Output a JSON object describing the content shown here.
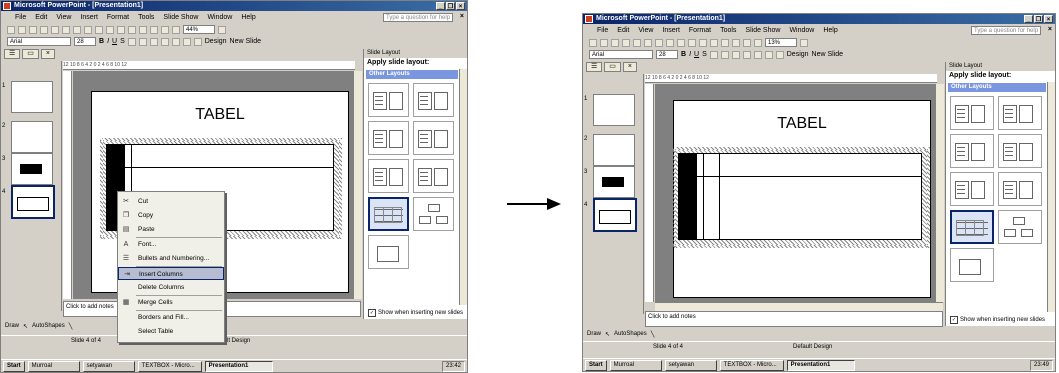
{
  "app_title": "Microsoft PowerPoint - [Presentation1]",
  "menu": [
    "File",
    "Edit",
    "View",
    "Insert",
    "Format",
    "Tools",
    "Slide Show",
    "Window",
    "Help"
  ],
  "help_placeholder": "Type a question for help",
  "formatting": {
    "font": "Arial",
    "size": "28",
    "bold": "B",
    "italic": "I",
    "underline": "U",
    "shadow": "S",
    "design_label": "Design",
    "new_slide_label": "New Slide"
  },
  "left": {
    "zoom": "44%",
    "ruler": "12 10 8 6 4 2 0 2 4 6 8 10 12",
    "notes_placeholder": "Click to add notes",
    "context_menu": [
      {
        "label": "Cut",
        "icon": "scissors-icon",
        "glyph": "✂"
      },
      {
        "label": "Copy",
        "icon": "copy-icon",
        "glyph": "❐"
      },
      {
        "label": "Paste",
        "icon": "paste-icon",
        "glyph": "▤"
      },
      {
        "label": "Font...",
        "icon": "font-icon",
        "glyph": "A"
      },
      {
        "label": "Bullets and Numbering...",
        "icon": "bullets-icon",
        "glyph": "☰"
      },
      {
        "label": "Insert Columns",
        "icon": "insert-columns-icon",
        "glyph": "⇥"
      },
      {
        "label": "Delete Columns",
        "icon": "",
        "glyph": ""
      },
      {
        "label": "Merge Cells",
        "icon": "merge-cells-icon",
        "glyph": "▦"
      },
      {
        "label": "Borders and Fill...",
        "icon": "",
        "glyph": ""
      },
      {
        "label": "Select Table",
        "icon": "",
        "glyph": ""
      }
    ],
    "task_time": "23:42"
  },
  "right": {
    "zoom": "13%",
    "ruler": "12 10 8 6 4 2 0 2 4 6 8 10 12",
    "notes_placeholder": "Click to add notes",
    "task_time": "23:49"
  },
  "slide_title": "TABEL",
  "thumbnails": [
    "1",
    "2",
    "3",
    "4"
  ],
  "task_pane": {
    "header": "Slide Layout",
    "title": "Apply slide layout:",
    "section": "Other Layouts",
    "checkbox_label": "Show when inserting new slides",
    "checkbox_mark": "✓"
  },
  "status": {
    "slide": "Slide 4 of 4",
    "design": "Default Design"
  },
  "draw_bar": {
    "draw_label": "Draw",
    "autoshapes_label": "AutoShapes"
  },
  "taskbar": {
    "start": "Start",
    "items": [
      "Murroal",
      "setyawan",
      "TEXTBOX - Micro...",
      "Presentation1"
    ]
  },
  "colors": {
    "title_bar": "#0a246a",
    "selection": "#b6bdd2",
    "pane_section": "#7a96df"
  }
}
